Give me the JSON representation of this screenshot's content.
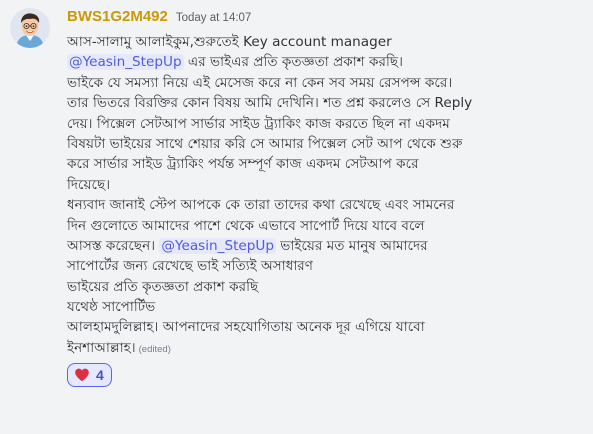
{
  "message": {
    "author": "BWS1G2M492",
    "timestamp": "Today at 14:07",
    "avatar_icon": "smiling-cartoon-man-with-glasses-avatar",
    "edited_label": "(edited)",
    "lines": [
      {
        "parts": [
          {
            "text": "আস-সালামু আলাইকুম,শুরুতেই Key account manager"
          }
        ]
      },
      {
        "parts": [
          {
            "mention": "@Yeasin_StepUp"
          },
          {
            "text": " এর ভাইএর প্রতি কৃতজ্ঞতা প্রকাশ করছি।"
          }
        ]
      },
      {
        "parts": [
          {
            "text": "ভাইকে যে সমস্যা নিয়ে এই মেসেজ করে না কেন সব সময় রেসপন্স করে।"
          }
        ]
      },
      {
        "parts": [
          {
            "text": "তার ভিতরে বিরক্তির কোন বিষয় আমি দেখিনি। শত প্রশ্ন করলেও সে Reply"
          }
        ]
      },
      {
        "parts": [
          {
            "text": "দেয়। পিক্সেল সেটআপ সার্ভার সাইড ট্র্যাকিং কাজ করতে ছিল না একদম"
          }
        ]
      },
      {
        "parts": [
          {
            "text": "বিষয়টা ভাইয়ের সাথে শেয়ার করি সে আমার পিক্সেল সেট আপ থেকে শুরু"
          }
        ]
      },
      {
        "parts": [
          {
            "text": "করে সার্ভার সাইড ট্র্যাকিং পর্যন্ত সম্পূর্ণ কাজ একদম সেটআপ করে"
          }
        ]
      },
      {
        "parts": [
          {
            "text": "দিয়েছে।"
          }
        ]
      },
      {
        "parts": [
          {
            "text": "ধন্যবাদ জানাই স্টেপ আপকে কে তারা তাদের কথা রেখেছে এবং সামনের"
          }
        ]
      },
      {
        "parts": [
          {
            "text": "দিন গুলোতে আমাদের পাশে থেকে এভাবে সাপোর্ট দিয়ে যাবে বলে"
          }
        ]
      },
      {
        "parts": [
          {
            "text": "আসস্ত করেছেন। "
          },
          {
            "mention": "@Yeasin_StepUp"
          },
          {
            "text": " ভাইয়ের মত মানুষ আমাদের"
          }
        ]
      },
      {
        "parts": [
          {
            "text": "সাপোর্টের জন্য রেখেছে ভাই সত্যিই অসাধারণ"
          }
        ]
      },
      {
        "parts": [
          {
            "text": " ভাইয়ের প্রতি কৃতজ্ঞতা প্রকাশ করছি"
          }
        ]
      },
      {
        "parts": [
          {
            "text": "যথেষ্ঠ সাপোর্টিভ"
          }
        ]
      },
      {
        "parts": [
          {
            "text": "আলহামদুলিল্লাহ। আপনাদের সহযোগিতায় অনেক দূর এগিয়ে যাবো"
          }
        ]
      },
      {
        "parts": [
          {
            "text": "ইনশাআল্লাহ।"
          }
        ],
        "edited": true
      }
    ],
    "reactions": [
      {
        "emoji": "red-heart-icon",
        "count": "4"
      }
    ]
  },
  "colors": {
    "background": "#f2f3f5",
    "author": "#c99a04",
    "mention_bg": "#e6e8fd",
    "mention_text": "#505cdc",
    "reaction_border": "#5865f2"
  }
}
